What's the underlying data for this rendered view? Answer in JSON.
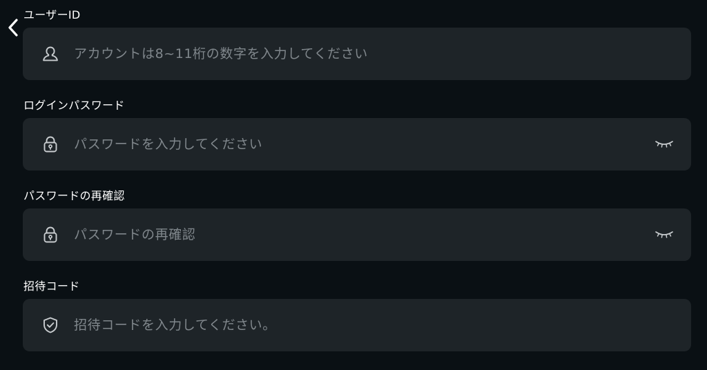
{
  "header": {
    "back_icon": "chevron-left-icon"
  },
  "form": {
    "user_id": {
      "label": "ユーザーID",
      "placeholder": "アカウントは8~11桁の数字を入力してください",
      "value": "",
      "icon": "user-icon"
    },
    "password": {
      "label": "ログインパスワード",
      "placeholder": "パスワードを入力してください",
      "value": "",
      "icon": "lock-icon",
      "toggle_icon": "eye-closed-icon"
    },
    "password_confirm": {
      "label": "パスワードの再確認",
      "placeholder": "パスワードの再確認",
      "value": "",
      "icon": "lock-icon",
      "toggle_icon": "eye-closed-icon"
    },
    "invite_code": {
      "label": "招待コード",
      "placeholder": "招待コードを入力してください。",
      "value": "",
      "icon": "shield-check-icon"
    }
  },
  "colors": {
    "background": "#0a1014",
    "field_background": "#1e2428",
    "label_text": "#ffffff",
    "placeholder_text": "#80878c",
    "icon": "#c9cdd0"
  }
}
